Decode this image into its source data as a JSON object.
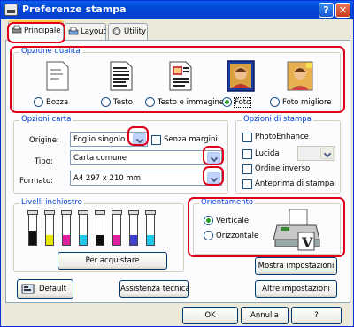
{
  "window": {
    "title": "Preferenze stampa"
  },
  "tabs": [
    {
      "label": "Principale",
      "active": true
    },
    {
      "label": "Layout",
      "active": false
    },
    {
      "label": "Utility",
      "active": false
    }
  ],
  "quality": {
    "title": "Opzione qualità",
    "options": [
      {
        "label": "Bozza",
        "selected": false,
        "icon": "draft-page-icon"
      },
      {
        "label": "Testo",
        "selected": false,
        "icon": "text-page-icon"
      },
      {
        "label": "Testo e immagine",
        "selected": false,
        "icon": "text-image-page-icon"
      },
      {
        "label": "Foto",
        "selected": true,
        "icon": "photo-icon"
      },
      {
        "label": "Foto migliore",
        "selected": false,
        "icon": "best-photo-icon"
      }
    ]
  },
  "paper": {
    "title": "Opzioni carta",
    "source_label": "Origine:",
    "source_value": "Foglio singolo",
    "borderless_label": "Senza margini",
    "borderless_checked": false,
    "type_label": "Tipo:",
    "type_value": "Carta comune",
    "format_label": "Formato:",
    "format_value": "A4 297 x 210 mm"
  },
  "print_options": {
    "title": "Opzioni di stampa",
    "photo_enhance_label": "PhotoEnhance",
    "glossy_label": "Lucida",
    "reverse_order_label": "Ordine inverso",
    "preview_label": "Anteprima di stampa"
  },
  "ink": {
    "title": "Livelli inchiostro",
    "buy_label": "Per acquistare",
    "colors": [
      "#101010",
      "#e8e800",
      "#e020a0",
      "#20c8e8",
      "#101010",
      "#e020a0",
      "#4040d0",
      "#20c8e8"
    ],
    "levels": [
      0.45,
      0.3,
      0.3,
      0.3,
      0.3,
      0.3,
      0.3,
      0.3
    ]
  },
  "orientation": {
    "title": "Orientamento",
    "portrait_label": "Verticale",
    "landscape_label": "Orizzontale",
    "selected": "portrait"
  },
  "buttons": {
    "show_settings": "Mostra impostazioni",
    "default": "Default",
    "tech_support": "Assistenza tecnica",
    "other_settings": "Altre impostazioni",
    "ok": "OK",
    "cancel": "Annulla",
    "help": "?"
  },
  "colors": {
    "highlight": "#e0001b",
    "group_title": "#0046d5",
    "titlebar": "#0246d6"
  }
}
